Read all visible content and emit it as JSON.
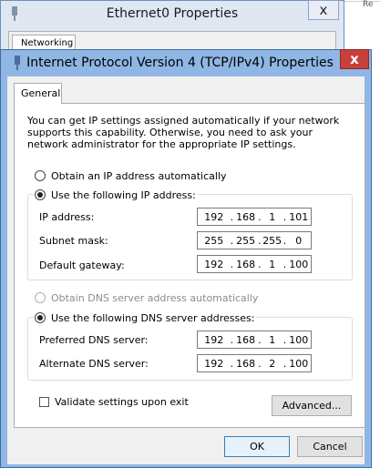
{
  "background_window": {
    "title": "Ethernet0 Properties",
    "tab_label": "Networking",
    "close_label": "x",
    "right_edge_text": "Re"
  },
  "dialog": {
    "title": "Internet Protocol Version 4 (TCP/IPv4) Properties",
    "close_label": "x",
    "tab_general": "General",
    "info_text": "You can get IP settings assigned automatically if your network supports this capability. Otherwise, you need to ask your network administrator for the appropriate IP settings.",
    "ip": {
      "auto_label": "Obtain an IP address automatically",
      "auto_selected": false,
      "manual_label": "Use the following IP address:",
      "manual_selected": true,
      "fields": [
        {
          "label": "IP address:",
          "octets": [
            "192",
            "168",
            "1",
            "101"
          ]
        },
        {
          "label": "Subnet mask:",
          "octets": [
            "255",
            "255",
            "255",
            "0"
          ]
        },
        {
          "label": "Default gateway:",
          "octets": [
            "192",
            "168",
            "1",
            "100"
          ]
        }
      ]
    },
    "dns": {
      "auto_label": "Obtain DNS server address automatically",
      "auto_disabled": true,
      "manual_label": "Use the following DNS server addresses:",
      "manual_selected": true,
      "fields": [
        {
          "label": "Preferred DNS server:",
          "octets": [
            "192",
            "168",
            "1",
            "100"
          ]
        },
        {
          "label": "Alternate DNS server:",
          "octets": [
            "192",
            "168",
            "2",
            "100"
          ]
        }
      ]
    },
    "validate_label": "Validate settings upon exit",
    "validate_checked": false,
    "advanced_label": "Advanced...",
    "ok_label": "OK",
    "cancel_label": "Cancel"
  }
}
